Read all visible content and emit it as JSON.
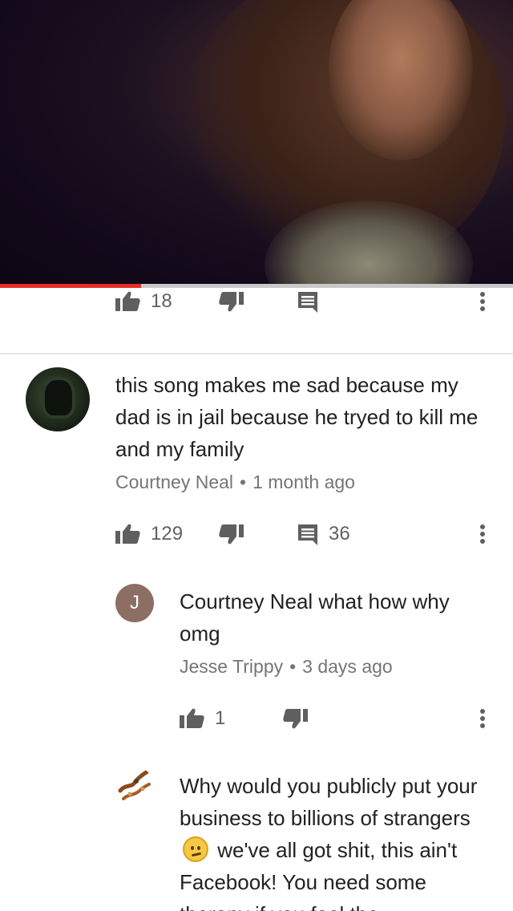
{
  "video": {
    "progress_fraction": 0.275
  },
  "top_comment_actions": {
    "likes": "18"
  },
  "comments": [
    {
      "text": "this song makes me sad because my dad is in jail because he tryed to kill me and my family",
      "author": "Courtney Neal",
      "separator": "•",
      "time": "1 month ago",
      "likes": "129",
      "replies": "36"
    }
  ],
  "replies": [
    {
      "avatar_letter": "J",
      "avatar_color": "#8d6e63",
      "text": "Courtney Neal what how why omg",
      "author": "Jesse Trippy",
      "separator": "•",
      "time": "3 days ago",
      "likes": "1"
    },
    {
      "text_before_emoji": "Why would you publicly put your business to billions of strangers",
      "emoji": "confused-face",
      "text_after_emoji": "we've all got shit, this ain't Facebook! You need some therapy if you feel the"
    }
  ]
}
